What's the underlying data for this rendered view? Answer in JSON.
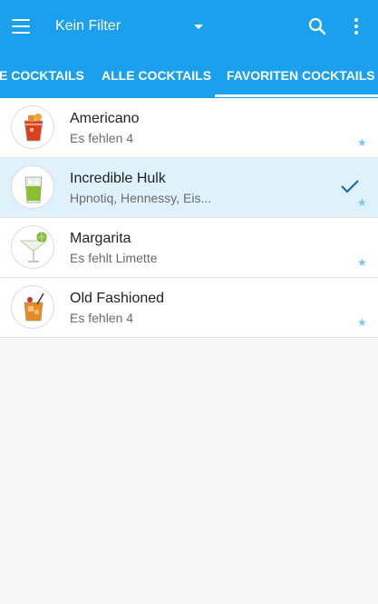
{
  "toolbar": {
    "filter_label": "Kein Filter",
    "menu_icon": "hamburger-menu-icon",
    "search_icon": "search-icon",
    "more_icon": "more-vertical-icon"
  },
  "tabs": [
    {
      "label": "E COCKTAILS",
      "selected": false
    },
    {
      "label": "ALLE COCKTAILS",
      "selected": false
    },
    {
      "label": "FAVORITEN COCKTAILS",
      "selected": true
    }
  ],
  "cocktails": [
    {
      "name": "Americano",
      "subtitle": "Es fehlen 4",
      "selected": false,
      "favorite": true
    },
    {
      "name": "Incredible Hulk",
      "subtitle": "Hpnotiq, Hennessy, Eis...",
      "selected": true,
      "favorite": true
    },
    {
      "name": "Margarita",
      "subtitle": "Es fehlt Limette",
      "selected": false,
      "favorite": true
    },
    {
      "name": "Old Fashioned",
      "subtitle": "Es fehlen 4",
      "selected": false,
      "favorite": true
    }
  ],
  "colors": {
    "app_bar": "#1aa0ec",
    "selected_row": "#dff1fb",
    "star": "#7fc3ef",
    "check": "#1a6fa8"
  }
}
